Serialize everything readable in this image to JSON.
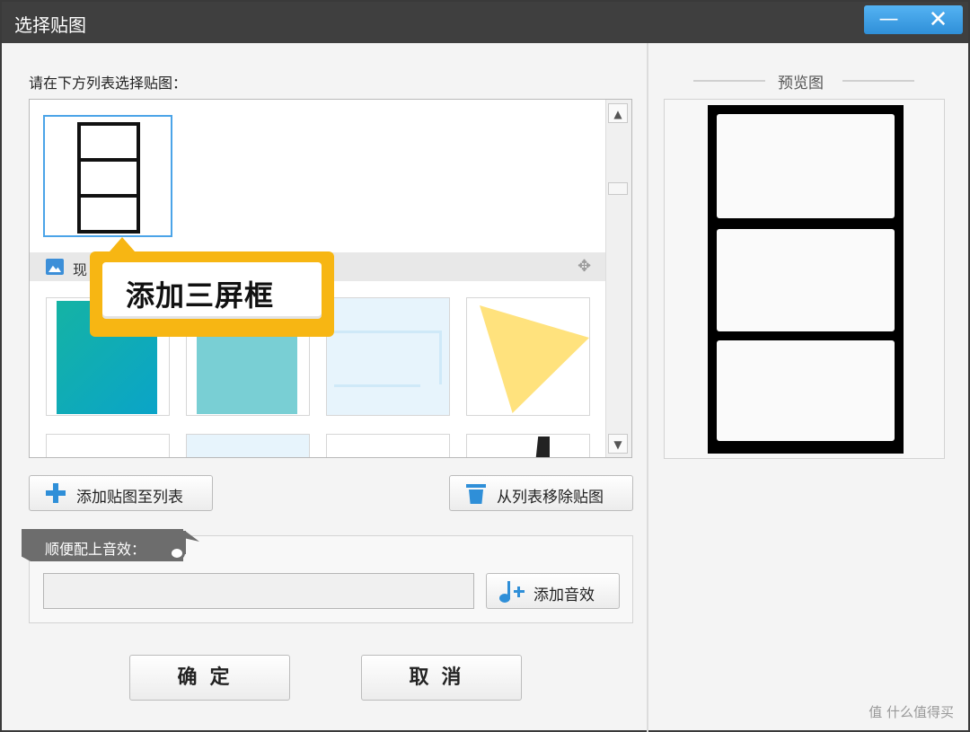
{
  "window": {
    "title": "选择贴图",
    "minimize_icon": "minimize-icon",
    "close_icon": "close-icon"
  },
  "left_panel": {
    "prompt": "请在下方列表选择贴图：",
    "category_label": "现",
    "callout_text": "添加三屏框",
    "buttons": {
      "add_to_list": "添加贴图至列表",
      "remove_from_list": "从列表移除贴图"
    },
    "sound": {
      "section_label": "顺便配上音效：",
      "input_value": "",
      "add_sound_button": "添加音效"
    },
    "ok_button": "确定",
    "cancel_button": "取消"
  },
  "right_panel": {
    "preview_title": "预览图"
  },
  "watermark": "值 什么值得买",
  "colors": {
    "accent": "#2f8fd8",
    "callout": "#f7b613",
    "selection": "#4ba4e8"
  }
}
